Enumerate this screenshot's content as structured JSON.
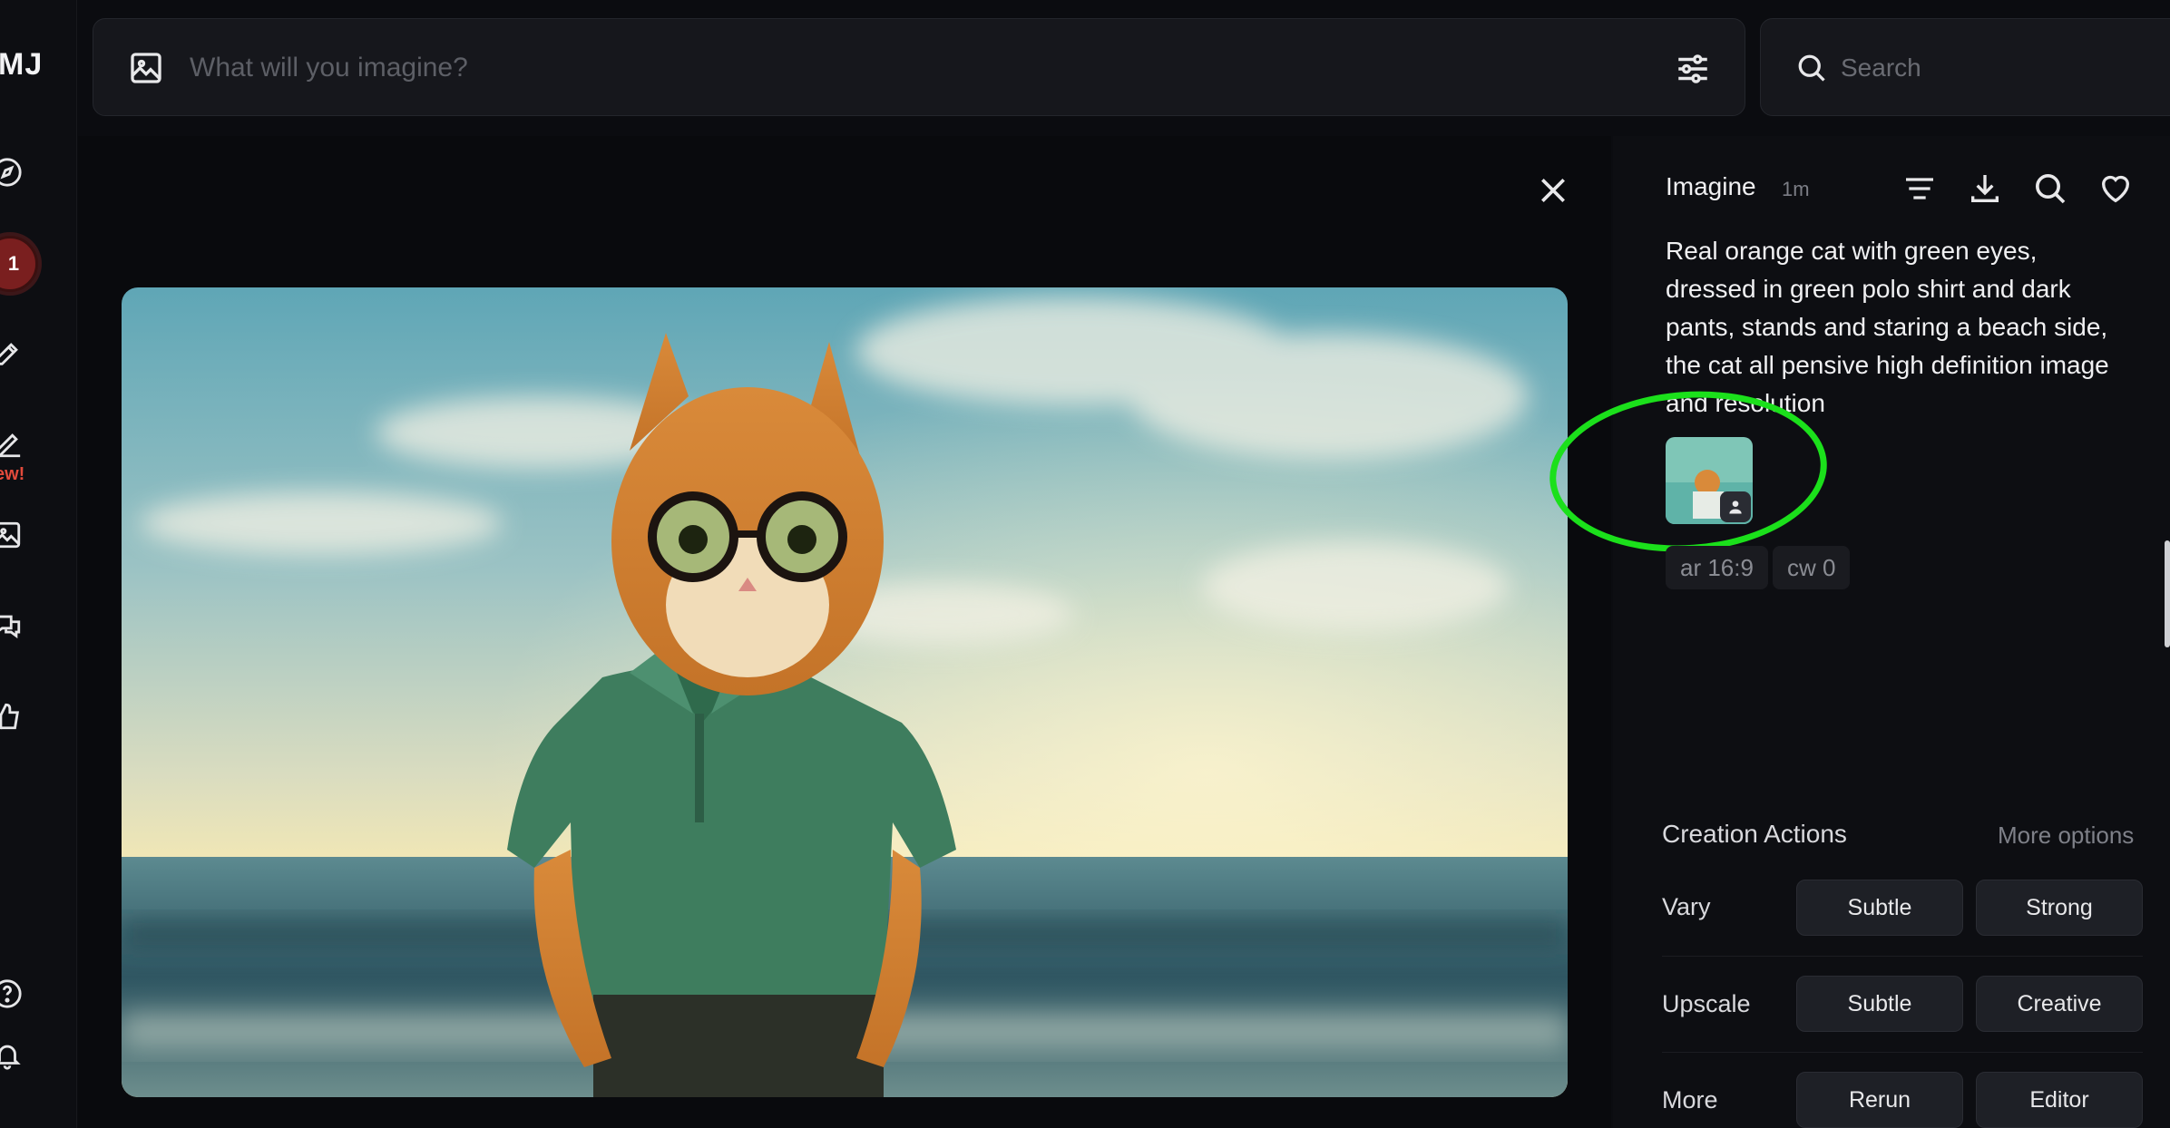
{
  "app": {
    "logo_text": "MJ",
    "new_badge": "ew!",
    "notification_count": "1"
  },
  "sidebar": {
    "items": [
      {
        "name": "explore",
        "icon": "compass-icon"
      },
      {
        "name": "notifications",
        "icon": "badge"
      },
      {
        "name": "create",
        "icon": "edit-icon"
      },
      {
        "name": "editor",
        "icon": "pen-new-icon"
      },
      {
        "name": "organize",
        "icon": "image-icon"
      },
      {
        "name": "chat",
        "icon": "chat-icon"
      },
      {
        "name": "tasks",
        "icon": "thumbs-up-icon"
      },
      {
        "name": "help",
        "icon": "help-icon"
      },
      {
        "name": "updates",
        "icon": "bell-icon"
      }
    ]
  },
  "prompt_bar": {
    "placeholder": "What will you imagine?"
  },
  "search": {
    "placeholder": "Search"
  },
  "detail": {
    "title": "Imagine",
    "time": "1m",
    "prompt": "Real orange cat with green eyes, dressed in green polo shirt and dark pants, stands and staring a beach side, the cat all pensive high definition image and resolution",
    "params": [
      "ar 16:9",
      "cw 0"
    ]
  },
  "creation_actions": {
    "title": "Creation Actions",
    "more_options": "More options",
    "rows": [
      {
        "label": "Vary",
        "buttons": [
          "Subtle",
          "Strong"
        ]
      },
      {
        "label": "Upscale",
        "buttons": [
          "Subtle",
          "Creative"
        ]
      },
      {
        "label": "More",
        "buttons": [
          "Rerun",
          "Editor"
        ]
      }
    ]
  },
  "colors": {
    "highlight": "#1be01b",
    "accent_red": "#e24a3b",
    "background": "#0b0c10"
  }
}
